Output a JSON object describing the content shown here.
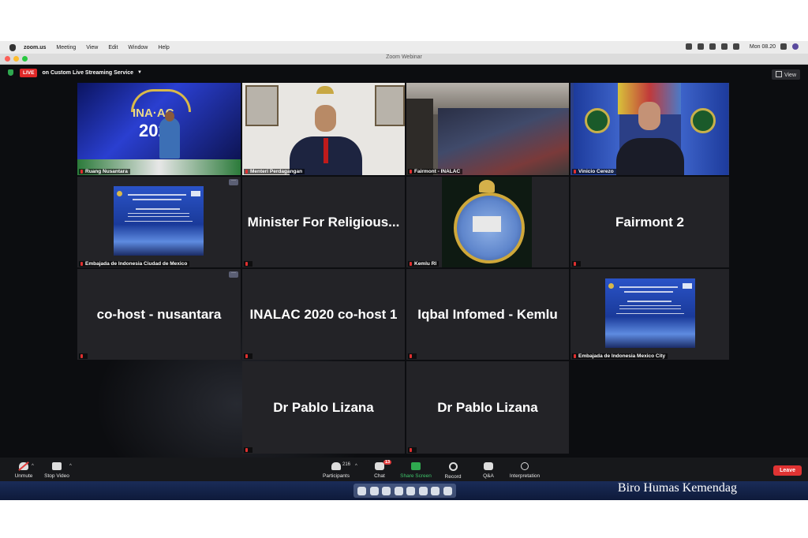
{
  "menubar": {
    "app": "zoom.us",
    "items": [
      "Meeting",
      "View",
      "Edit",
      "Window",
      "Help"
    ],
    "clock": "Mon 08.20"
  },
  "window": {
    "title": "Zoom Webinar"
  },
  "streaming": {
    "live_label": "LIVE",
    "status": "on Custom Live Streaming Service"
  },
  "view_button": {
    "label": "View"
  },
  "tiles": [
    {
      "label": "Ruang Nusantara"
    },
    {
      "label": "Menteri Perdagangan"
    },
    {
      "label": "Fairmont - INALAC"
    },
    {
      "label": "Vinicio Cerezo"
    },
    {
      "label": "Embajada de Indonesia Ciudad de Mexico"
    },
    {
      "name": "Minister For Religious..."
    },
    {
      "label": "Kemlu RI"
    },
    {
      "name": "Fairmont 2"
    },
    {
      "name": "co-host - nusantara"
    },
    {
      "name": "INALAC 2020 co-host 1"
    },
    {
      "name": "Iqbal Infomed - Kemlu"
    },
    {
      "label": "Embajada de Indonesia Mexico City"
    },
    {
      "name": "Dr Pablo Lizana"
    },
    {
      "name": "Dr Pablo Lizana"
    }
  ],
  "toolbar": {
    "unmute": "Unmute",
    "stop_video": "Stop Video",
    "participants": "Participants",
    "participants_count": "216",
    "chat": "Chat",
    "chat_badge": "13",
    "share_screen": "Share Screen",
    "record": "Record",
    "qa": "Q&A",
    "interpretation": "Interpretation",
    "leave": "Leave"
  },
  "watermark": "Biro Humas Kemendag",
  "colors": {
    "live": "#e02828",
    "share": "#2fa84f",
    "leave": "#e03333",
    "active_speaker": "#e2e03a"
  }
}
